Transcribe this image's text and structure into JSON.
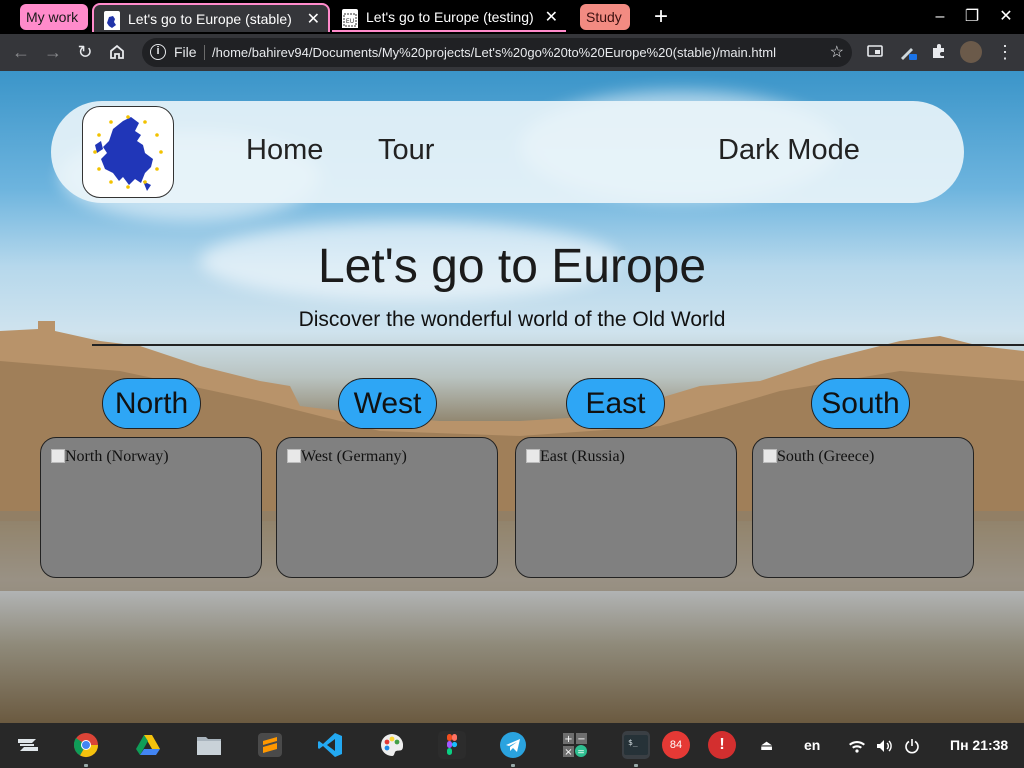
{
  "browser": {
    "tab_groups": [
      {
        "label": "My work",
        "color": "#ff8bcb"
      },
      {
        "label": "Study",
        "color": "#f28b82"
      }
    ],
    "tabs": [
      {
        "title": "Let's go to Europe (stable)",
        "active": true
      },
      {
        "title": "Let's go to Europe (testing)",
        "active": false
      }
    ],
    "new_tab_label": "+",
    "window_controls": {
      "minimize": "‒",
      "maximize": "❐",
      "close": "✕"
    },
    "omnibox": {
      "scheme_label": "File",
      "url": "/home/bahirev94/Documents/My%20projects/Let's%20go%20to%20Europe%20(stable)/main.html"
    }
  },
  "page": {
    "nav": {
      "links": [
        "Home",
        "Tour"
      ],
      "dark_mode_label": "Dark Mode"
    },
    "hero": {
      "title": "Let's go to Europe",
      "subtitle": "Discover the wonderful world of the Old World"
    },
    "regions": [
      {
        "label": "North",
        "image_alt": "North (Norway)"
      },
      {
        "label": "West",
        "image_alt": "West (Germany)"
      },
      {
        "label": "East",
        "image_alt": "East (Russia)"
      },
      {
        "label": "South",
        "image_alt": "South (Greece)"
      }
    ]
  },
  "taskbar": {
    "apps": [
      "zorin-menu",
      "chrome",
      "google-drive",
      "files",
      "sublime-text",
      "vscode",
      "color-picker",
      "figma",
      "telegram",
      "calculator",
      "terminal",
      "updates",
      "alerts"
    ],
    "badge_count": "84",
    "keyboard_layout": "en",
    "clock": "Пн 21:38"
  },
  "colors": {
    "accent_pink": "#ff8bcb",
    "pill_blue": "#2ea6f5",
    "card_gray": "#808080"
  }
}
